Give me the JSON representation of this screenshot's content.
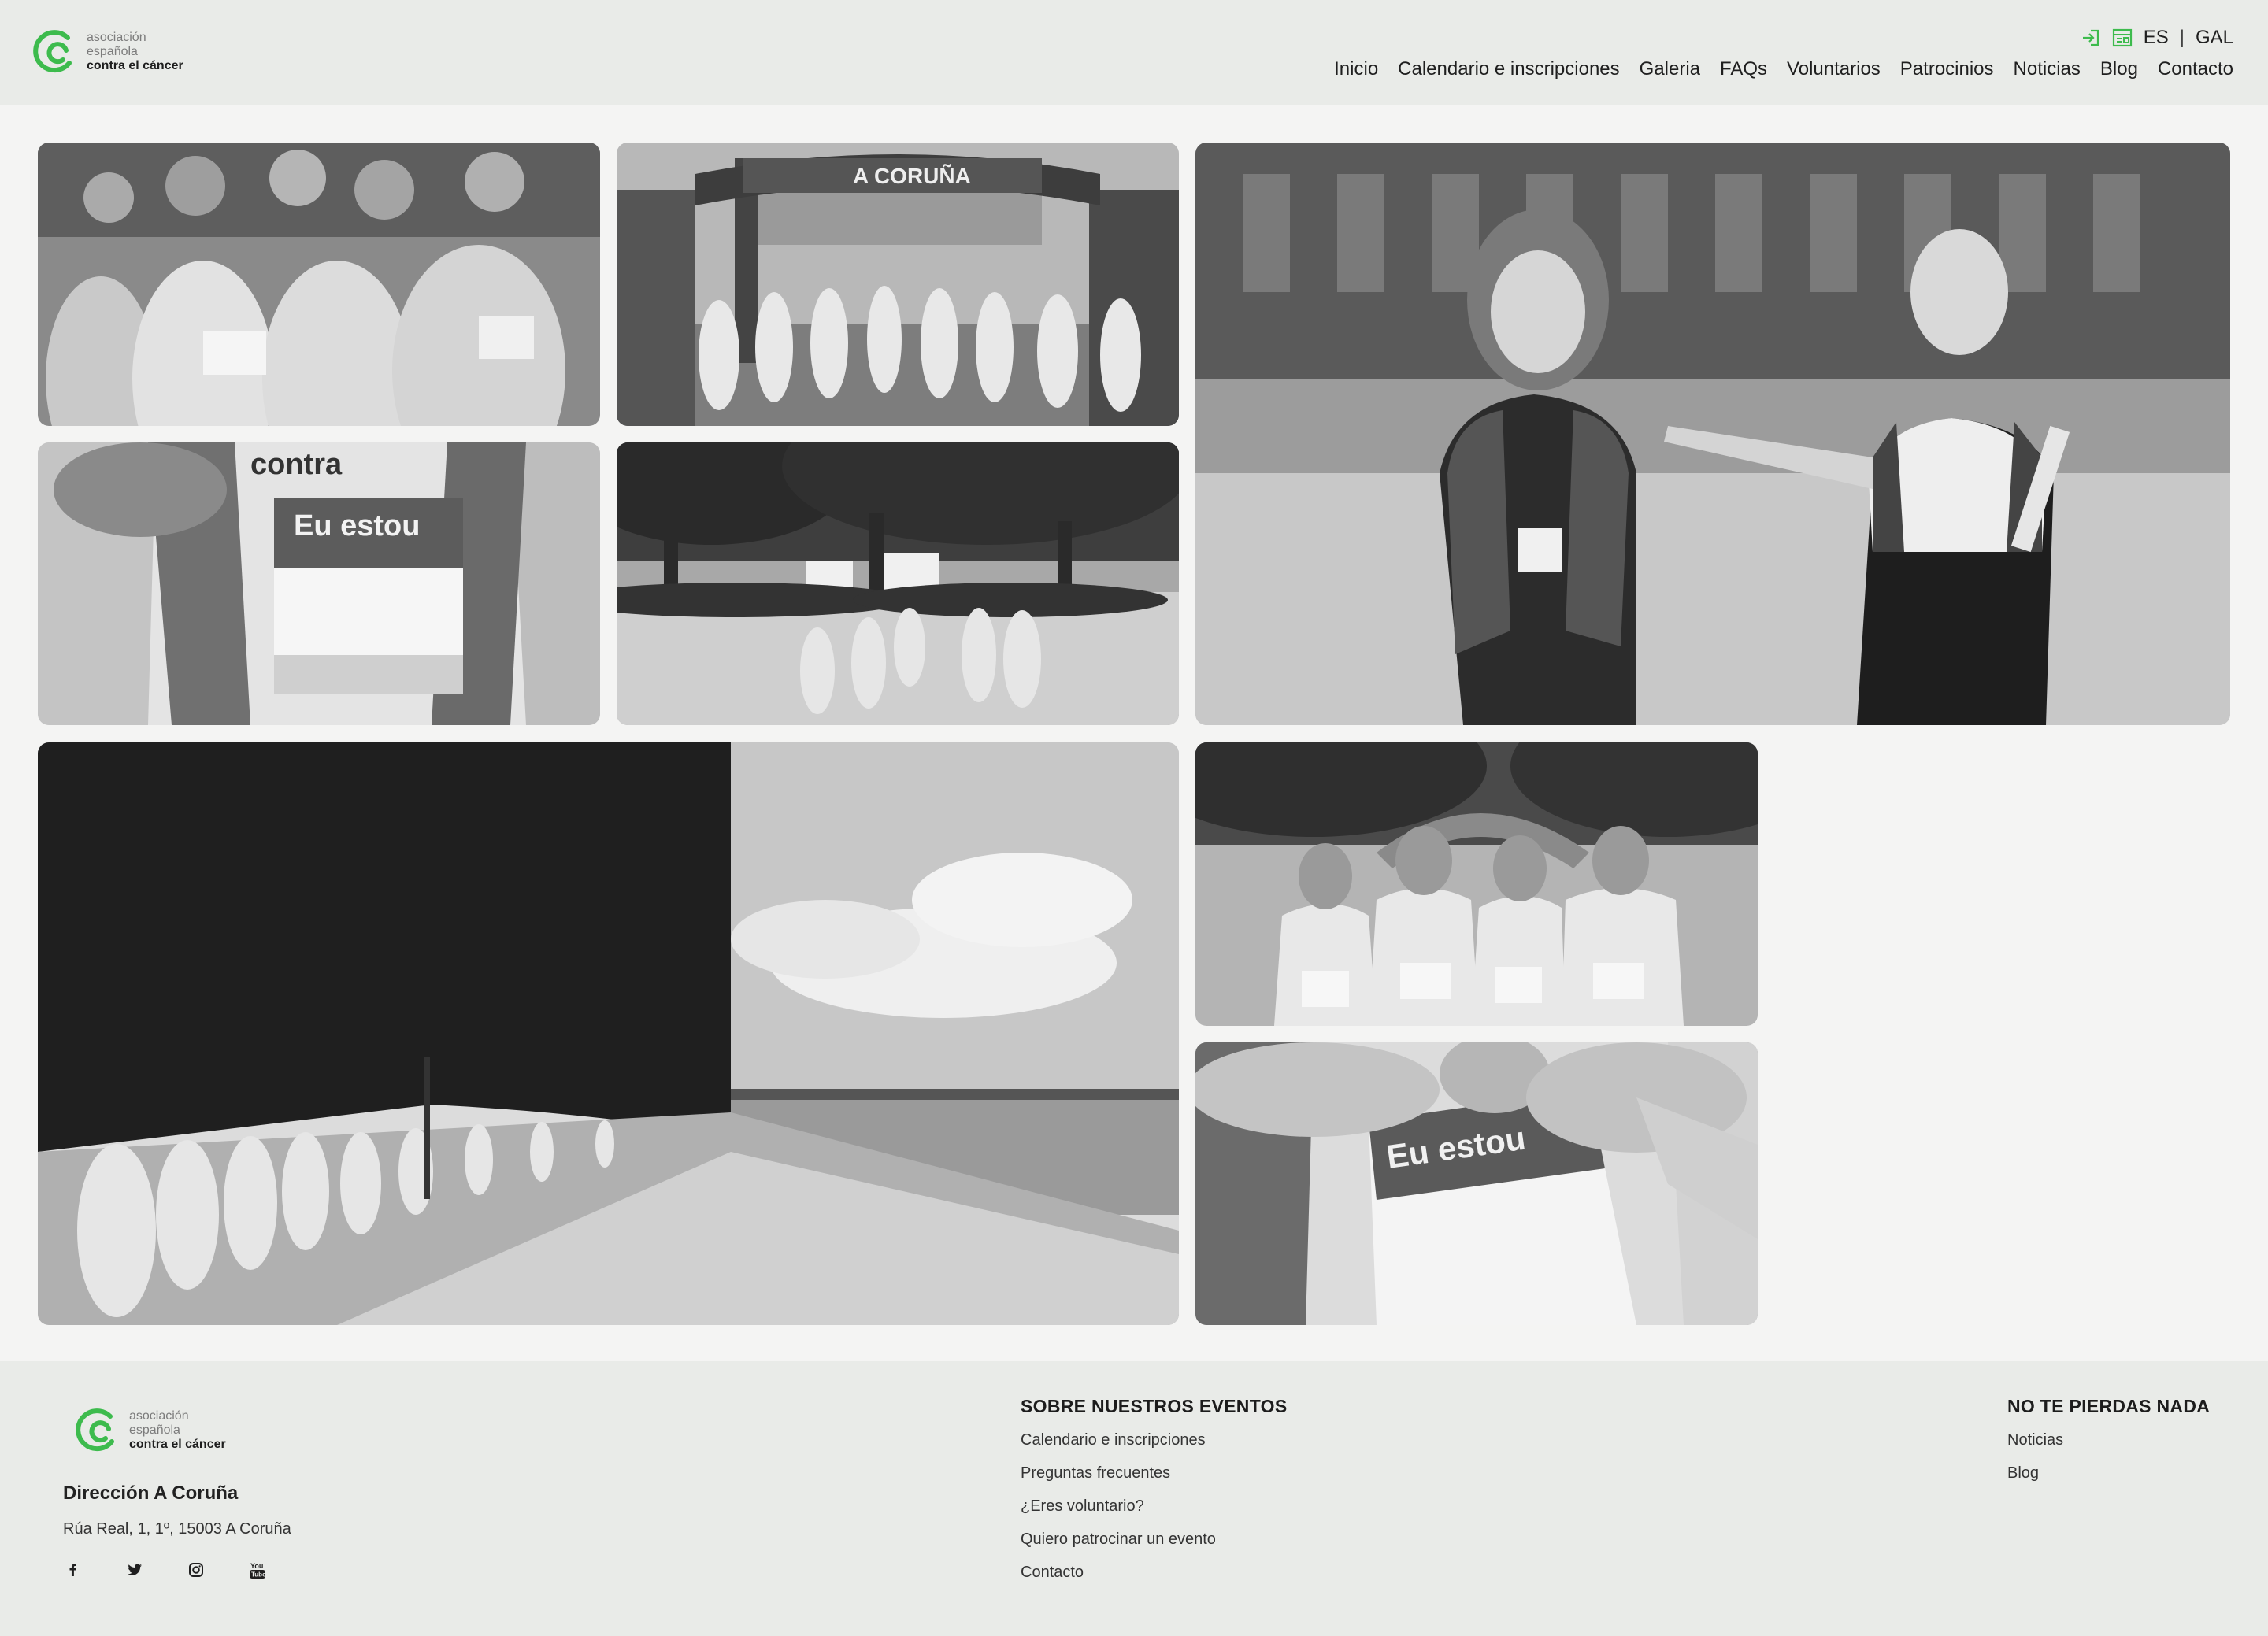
{
  "brand": {
    "line1": "asociación",
    "line2": "española",
    "line3": "contra el cáncer",
    "color": "#3dbb4d"
  },
  "header": {
    "icons": [
      "login-icon",
      "register-icon"
    ],
    "lang_es": "ES",
    "lang_sep": "|",
    "lang_gal": "GAL",
    "nav": [
      {
        "label": "Inicio"
      },
      {
        "label": "Calendario e inscripciones"
      },
      {
        "label": "Galeria"
      },
      {
        "label": "FAQs"
      },
      {
        "label": "Voluntarios"
      },
      {
        "label": "Patrocinios"
      },
      {
        "label": "Noticias"
      },
      {
        "label": "Blog"
      },
      {
        "label": "Contacto"
      }
    ]
  },
  "gallery": {
    "photos": [
      {
        "name": "photo-group-smiling-participants"
      },
      {
        "name": "photo-finish-arch-walkers",
        "visible_text": "A CORUÑA"
      },
      {
        "name": "photo-volunteers-walking",
        "visible_text": ""
      },
      {
        "name": "photo-race-bib-closeup",
        "visible_text": "Eu estou"
      },
      {
        "name": "photo-park-crowd"
      },
      {
        "name": "photo-coastal-walk"
      },
      {
        "name": "photo-four-participants"
      },
      {
        "name": "photo-hands-holding-bib",
        "visible_text": "Eu estou"
      }
    ]
  },
  "footer": {
    "office": "Dirección A Coruña",
    "address": "Rúa Real, 1, 1º, 15003 A Coruña",
    "social": [
      "facebook-icon",
      "twitter-icon",
      "instagram-icon",
      "youtube-icon"
    ],
    "events_title": "SOBRE NUESTROS EVENTOS",
    "events_links": [
      {
        "label": "Calendario e inscripciones"
      },
      {
        "label": "Preguntas frecuentes"
      },
      {
        "label": "¿Eres voluntario?"
      },
      {
        "label": "Quiero patrocinar un evento"
      },
      {
        "label": "Contacto"
      }
    ],
    "news_title": "NO TE PIERDAS NADA",
    "news_links": [
      {
        "label": "Noticias"
      },
      {
        "label": "Blog"
      }
    ]
  }
}
